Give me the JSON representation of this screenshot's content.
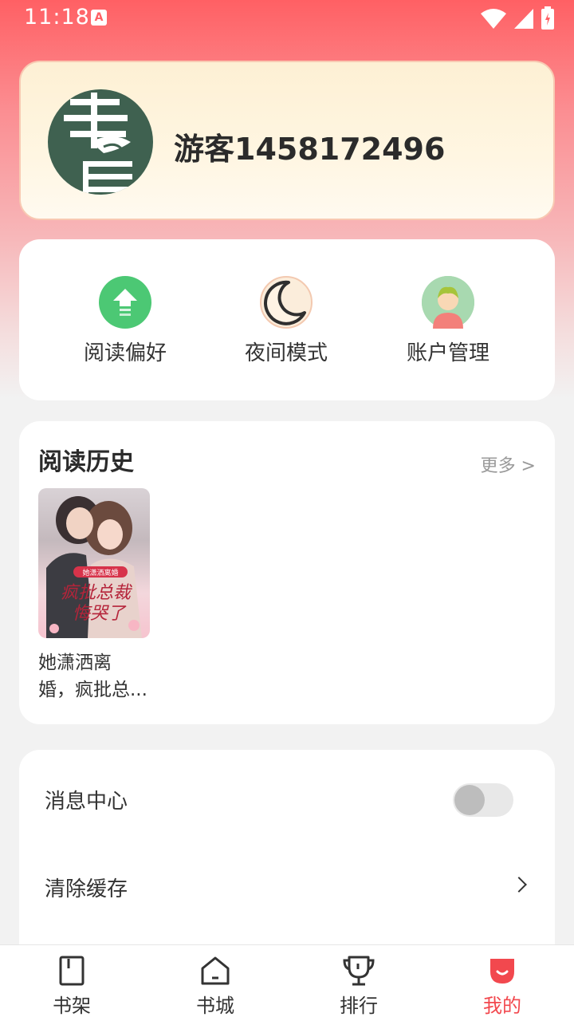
{
  "status_bar": {
    "time": "11:18",
    "notification_badge": "A"
  },
  "profile": {
    "username": "游客1458172496",
    "avatar_icon": "calligraphy-avatar"
  },
  "quick_actions": [
    {
      "label": "阅读偏好",
      "icon": "upload-arrow-icon",
      "color": "#4cc874"
    },
    {
      "label": "夜间模式",
      "icon": "moon-icon",
      "color": "#f8e7d2"
    },
    {
      "label": "账户管理",
      "icon": "user-avatar-icon",
      "color": "#9ed6a6"
    }
  ],
  "history": {
    "title": "阅读历史",
    "more_label": "更多 >",
    "books": [
      {
        "title_line1": "她潇洒离",
        "title_line2": "婚，疯批总...",
        "cover_text_top": "她潇洒离婚",
        "cover_text_main1": "疯批总裁",
        "cover_text_main2": "悔哭了"
      }
    ]
  },
  "settings": {
    "message_center_label": "消息中心",
    "message_center_enabled": false,
    "clear_cache_label": "清除缓存"
  },
  "tabs": [
    {
      "label": "书架",
      "icon": "bookshelf-icon",
      "active": false
    },
    {
      "label": "书城",
      "icon": "home-store-icon",
      "active": false
    },
    {
      "label": "排行",
      "icon": "trophy-icon",
      "active": false
    },
    {
      "label": "我的",
      "icon": "profile-icon",
      "active": true
    }
  ],
  "colors": {
    "accent": "#f2484e",
    "header_gradient_top": "#ff6064"
  }
}
